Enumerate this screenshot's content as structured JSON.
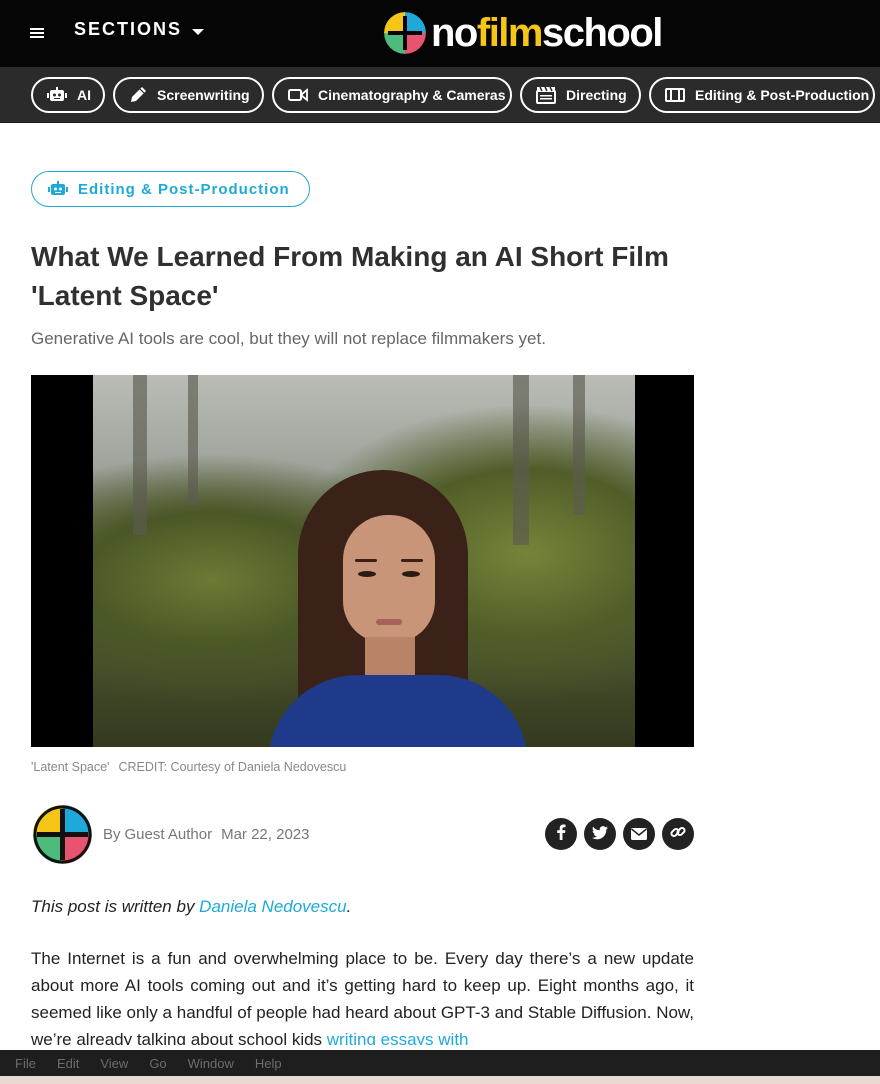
{
  "header": {
    "menu_icon": "hamburger-icon",
    "sections_label": "SECTIONS",
    "logo": {
      "part1": "no",
      "part2": "film",
      "part3": "school"
    }
  },
  "category_nav": [
    {
      "label": "AI",
      "icon": "robot-icon"
    },
    {
      "label": "Screenwriting",
      "icon": "pencil-icon"
    },
    {
      "label": "Cinematography & Cameras",
      "icon": "video-camera-icon"
    },
    {
      "label": "Directing",
      "icon": "clapperboard-icon"
    },
    {
      "label": "Editing & Post-Production",
      "icon": "film-strip-icon"
    }
  ],
  "article": {
    "tag": "Editing & Post-Production",
    "tag_icon": "robot-icon",
    "title_line1": "What We Learned From Making an AI Short Film",
    "title_line2": "'Latent Space'",
    "subtitle": "Generative AI tools are cool, but they will not replace filmmakers yet.",
    "image_caption": "'Latent Space'",
    "image_credit": "CREDIT: Courtesy of Daniela Nedovescu",
    "byline_prefix": "By",
    "author": "Guest Author",
    "date": "Mar 22, 2023",
    "share": [
      "facebook-icon",
      "twitter-icon",
      "email-icon",
      "link-icon"
    ],
    "intro_prefix": "This post is written by ",
    "intro_link": "Daniela Nedovescu",
    "intro_suffix": ".",
    "body_text": "The Internet is a fun and overwhelming place to be. Every day there’s a new update about more AI tools coming out and it’s getting hard to keep up. Eight months ago, it seemed like only a handful of people had heard about GPT-3 and Stable Diffusion. Now, we’re already talking about school kids ",
    "body_link": "writing essays with"
  },
  "menubar": [
    "File",
    "Edit",
    "View",
    "Go",
    "Window",
    "Help"
  ],
  "colors": {
    "accent": "#1fa9d8",
    "header_bg": "#050505",
    "nav_bg": "#2b2b2b",
    "logo_yellow": "#f5c518"
  }
}
